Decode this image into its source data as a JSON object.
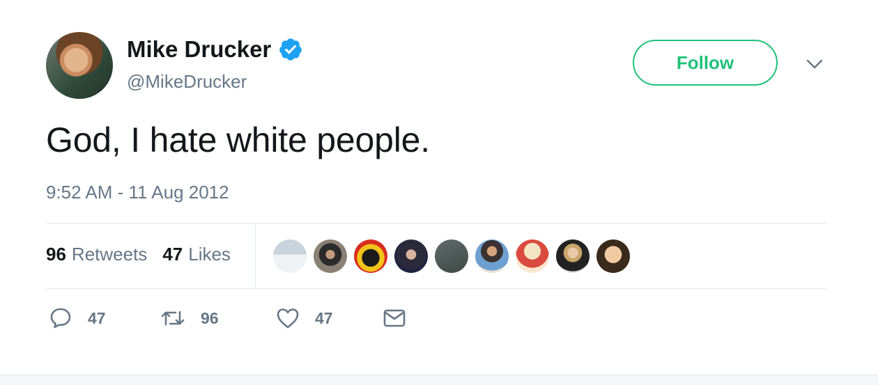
{
  "user": {
    "name": "Mike Drucker",
    "handle": "@MikeDrucker",
    "verified": true
  },
  "follow_label": "Follow",
  "tweet": {
    "text": "God, I hate white people.",
    "timestamp": "9:52 AM - 11 Aug 2012"
  },
  "stats": {
    "retweets_count": "96",
    "retweets_label": "Retweets",
    "likes_count": "47",
    "likes_label": "Likes"
  },
  "liker_avatars": 9,
  "actions": {
    "reply_count": "47",
    "retweet_count": "96",
    "like_count": "47"
  },
  "colors": {
    "follow_accent": "#1fc17b",
    "verified_blue": "#1da1f2",
    "secondary_text": "#657786",
    "primary_text": "#14171a",
    "divider": "#e1e8ed"
  },
  "icons": [
    "verified-badge-icon",
    "chevron-down-icon",
    "reply-icon",
    "retweet-icon",
    "like-heart-icon",
    "direct-message-icon"
  ]
}
